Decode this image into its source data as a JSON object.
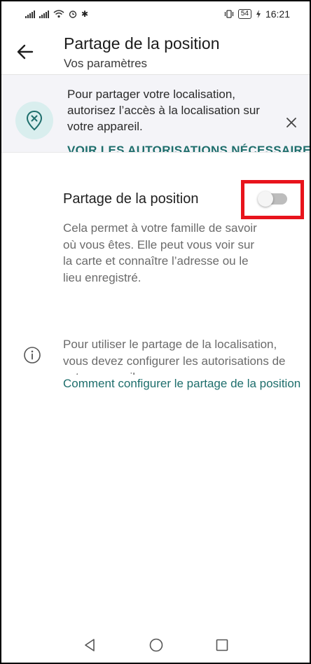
{
  "status_bar": {
    "battery": "54",
    "time": "16:21"
  },
  "app_bar": {
    "title": "Partage de la position",
    "subtitle": "Vos paramètres"
  },
  "banner": {
    "text": "Pour partager votre localisation, autorisez l’accès à la localisation sur votre appareil.",
    "link": "VOIR LES AUTORISATIONS NÉCESSAIRES"
  },
  "location_setting": {
    "title": "Partage de la position",
    "enabled": false,
    "description": "Cela permet à votre famille de savoir où vous êtes. Elle peut vous voir sur la carte et connaître l’adresse ou le lieu enregistré."
  },
  "info": {
    "text": "Pour utiliser le partage de la localisation, vous devez configurer les autorisations de votre appareil",
    "link": "Comment configurer le partage de la position"
  },
  "colors": {
    "accent": "#1e6e6c",
    "highlight_frame": "#e8141c",
    "banner_bg": "#f4f4f8",
    "icon_circle": "#d9eeee"
  },
  "icons": {
    "back": "arrow-left",
    "location_off": "location-pin-x",
    "close": "x",
    "info": "info-circle"
  }
}
